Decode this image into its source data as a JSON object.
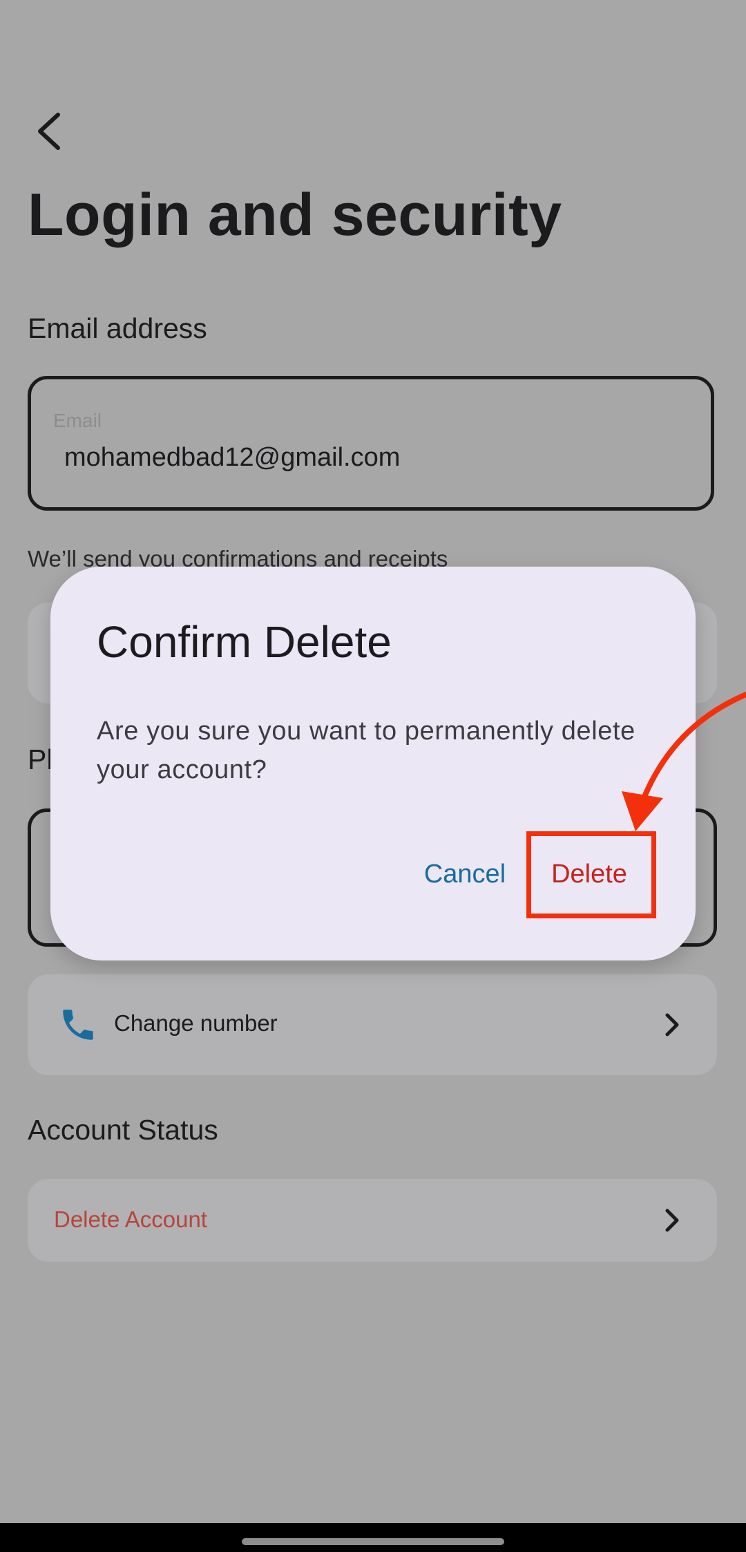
{
  "page": {
    "title": "Login and security"
  },
  "email_section": {
    "heading": "Email address",
    "field_label": "Email",
    "field_value": "mohamedbad12@gmail.com",
    "helper_text": "We’ll send you confirmations and receipts"
  },
  "phone_section": {
    "heading": "Ph",
    "change_number_label": "Change number"
  },
  "account_status": {
    "heading": "Account Status",
    "delete_label": "Delete Account"
  },
  "dialog": {
    "title": "Confirm Delete",
    "message": "Are you sure you want to permanently delete your account?",
    "cancel_label": "Cancel",
    "delete_label": "Delete"
  },
  "icons": {
    "back": "chevron-left-icon",
    "phone": "phone-icon",
    "chevron": "chevron-right-icon"
  },
  "colors": {
    "accent_blue": "#1a6c9d",
    "danger_red": "#c8231e",
    "annotation_red": "#f4300c",
    "dialog_bg": "#ece7f4",
    "scrim_bg": "#a7a7a8"
  }
}
